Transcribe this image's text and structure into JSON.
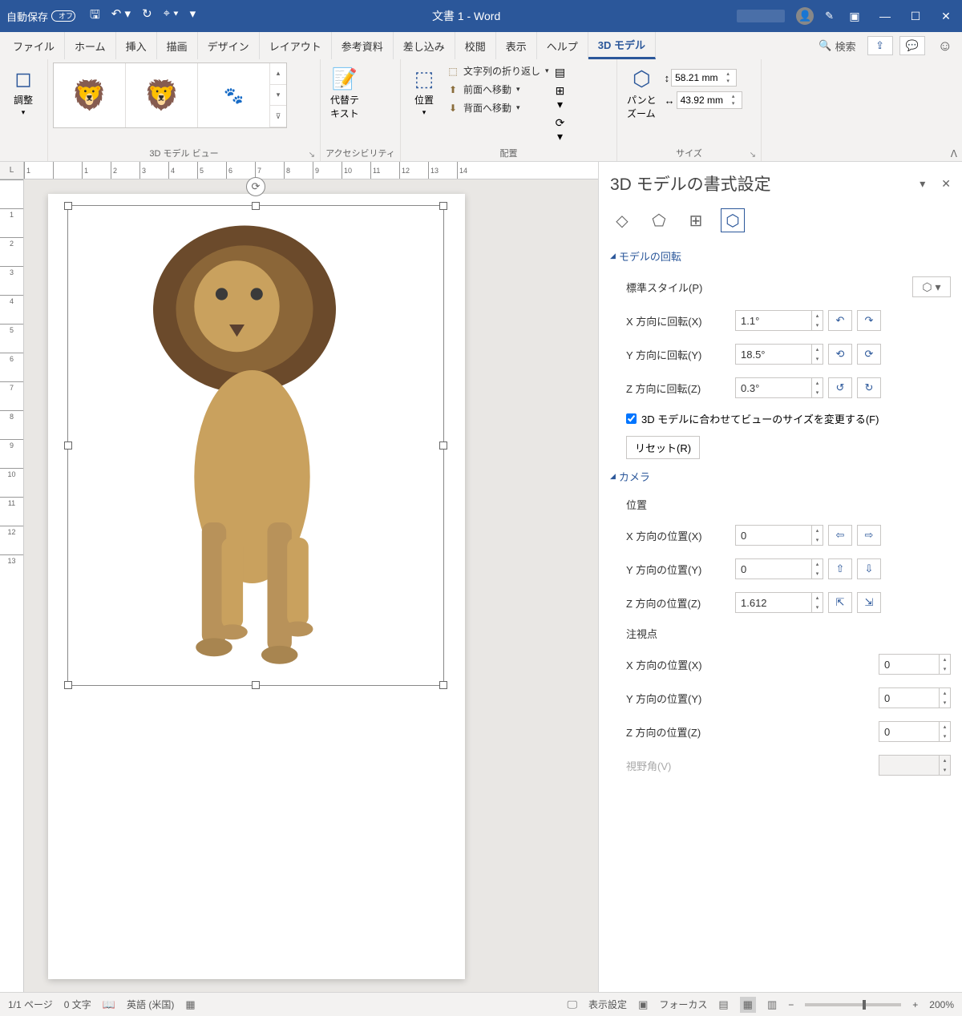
{
  "titlebar": {
    "autosave": "自動保存",
    "title": "文書 1 - Word"
  },
  "tabs": {
    "file": "ファイル",
    "home": "ホーム",
    "insert": "挿入",
    "draw": "描画",
    "design": "デザイン",
    "layout": "レイアウト",
    "references": "参考資料",
    "mailings": "差し込み",
    "review": "校閲",
    "view": "表示",
    "help": "ヘルプ",
    "model3d": "3D モデル",
    "search": "検索"
  },
  "ribbon": {
    "adjust": "調整",
    "views_label": "3D モデル ビュー",
    "alt_text": "代替テ\nキスト",
    "accessibility": "アクセシビリティ",
    "position": "位置",
    "wrap": "文字列の折り返し",
    "forward": "前面へ移動",
    "backward": "背面へ移動",
    "arrange_label": "配置",
    "pan_zoom": "パンと\nズーム",
    "height": "58.21 mm",
    "width": "43.92 mm",
    "size_label": "サイズ"
  },
  "pane": {
    "title": "3D モデルの書式設定",
    "section_rotation": "モデルの回転",
    "preset": "標準スタイル(P)",
    "x_rot_label": "X 方向に回転(X)",
    "x_rot": "1.1°",
    "y_rot_label": "Y 方向に回転(Y)",
    "y_rot": "18.5°",
    "z_rot_label": "Z 方向に回転(Z)",
    "z_rot": "0.3°",
    "fit_view": "3D モデルに合わせてビューのサイズを変更する(F)",
    "reset": "リセット(R)",
    "section_camera": "カメラ",
    "position_label": "位置",
    "x_pos_label": "X 方向の位置(X)",
    "x_pos": "0",
    "y_pos_label": "Y 方向の位置(Y)",
    "y_pos": "0",
    "z_pos_label": "Z 方向の位置(Z)",
    "z_pos": "1.612",
    "look_at": "注視点",
    "lx_label": "X 方向の位置(X)",
    "lx": "0",
    "ly_label": "Y 方向の位置(Y)",
    "ly": "0",
    "lz_label": "Z 方向の位置(Z)",
    "lz": "0",
    "fov_label": "視野角(V)"
  },
  "status": {
    "page": "1/1 ページ",
    "words": "0 文字",
    "lang": "英語 (米国)",
    "display": "表示設定",
    "focus": "フォーカス",
    "zoom": "200%"
  }
}
